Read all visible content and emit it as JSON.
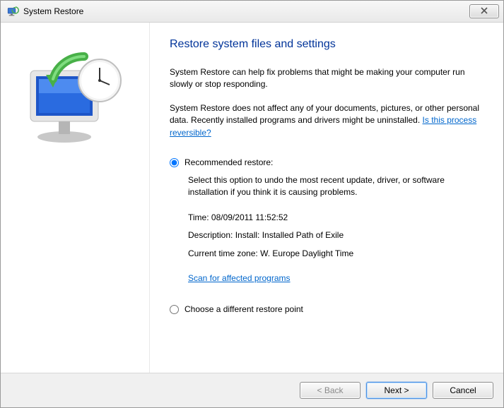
{
  "titlebar": {
    "title": "System Restore"
  },
  "heading": "Restore system files and settings",
  "intro1": "System Restore can help fix problems that might be making your computer run slowly or stop responding.",
  "intro2_prefix": "System Restore does not affect any of your documents, pictures, or other personal data. Recently installed programs and drivers might be uninstalled. ",
  "intro2_link": "Is this process reversible?",
  "option_recommended": {
    "label": "Recommended restore:",
    "desc": "Select this option to undo the most recent update, driver, or software installation if you think it is causing problems.",
    "time_label": "Time:",
    "time_value": "08/09/2011 11:52:52",
    "description_label": "Description:",
    "description_value": "Install: Installed Path of Exile",
    "tz_label": "Current time zone:",
    "tz_value": "W. Europe Daylight Time",
    "scan_link": "Scan for affected programs"
  },
  "option_different": {
    "label": "Choose a different restore point"
  },
  "buttons": {
    "back": "< Back",
    "next": "Next >",
    "cancel": "Cancel"
  }
}
